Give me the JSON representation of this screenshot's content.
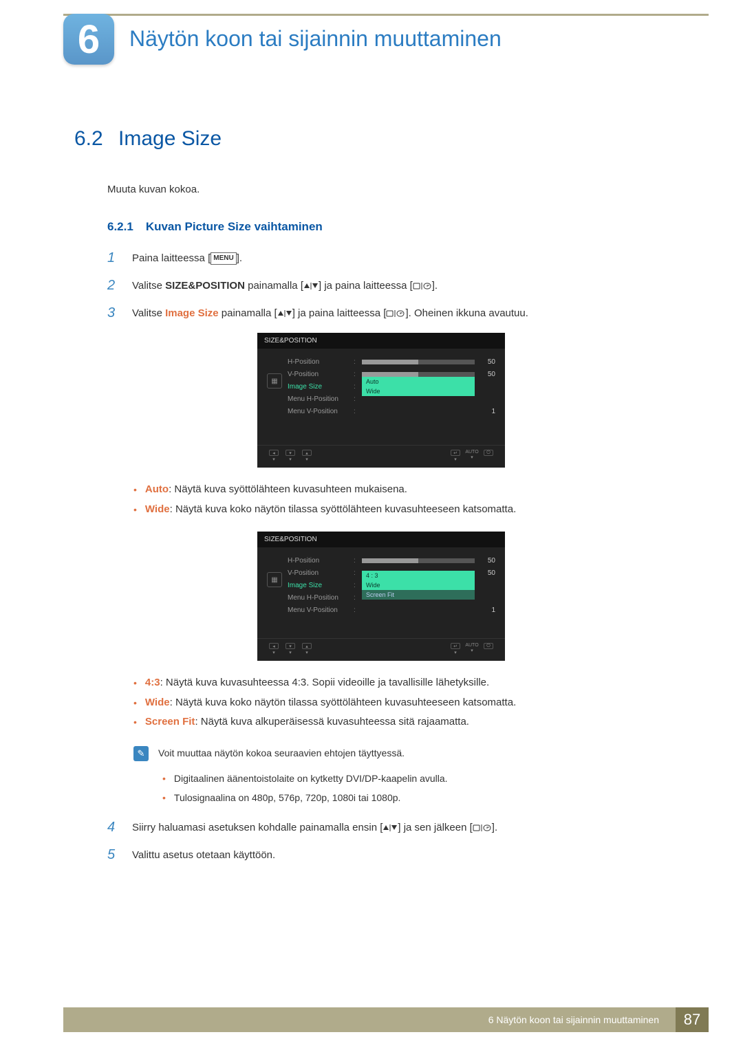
{
  "chapter": {
    "number": "6",
    "title": "Näytön koon tai sijainnin muuttaminen"
  },
  "section": {
    "number": "6.2",
    "title": "Image Size"
  },
  "intro": "Muuta kuvan kokoa.",
  "subsection": {
    "number": "6.2.1",
    "title": "Kuvan Picture Size vaihtaminen"
  },
  "steps": {
    "s1_num": "1",
    "s1_a": "Paina laitteessa [",
    "s1_menu": "MENU",
    "s1_b": "].",
    "s2_num": "2",
    "s2_a": "Valitse ",
    "s2_kw": "SIZE&POSITION",
    "s2_b": " painamalla [",
    "s2_c": "] ja paina laitteessa [",
    "s2_d": "].",
    "s3_num": "3",
    "s3_a": "Valitse ",
    "s3_kw": "Image Size",
    "s3_b": " painamalla [",
    "s3_c": "] ja paina laitteessa [",
    "s3_d": "]. Oheinen ikkuna avautuu.",
    "s4_num": "4",
    "s4_a": "Siirry haluamasi asetuksen kohdalle painamalla ensin [",
    "s4_b": "] ja sen jälkeen [",
    "s4_c": "].",
    "s5_num": "5",
    "s5_text": "Valittu asetus otetaan käyttöön."
  },
  "osd1": {
    "title": "SIZE&POSITION",
    "rows": {
      "hpos": "H-Position",
      "vpos": "V-Position",
      "imgsize": "Image Size",
      "mhpos": "Menu H-Position",
      "mvpos": "Menu V-Position"
    },
    "vals": {
      "hpos": "50",
      "vpos": "50",
      "mvpos": "1"
    },
    "options": {
      "o1": "Auto",
      "o2": "Wide"
    },
    "footer_auto": "AUTO"
  },
  "osd2": {
    "title": "SIZE&POSITION",
    "rows": {
      "hpos": "H-Position",
      "vpos": "V-Position",
      "imgsize": "Image Size",
      "mhpos": "Menu H-Position",
      "mvpos": "Menu V-Position"
    },
    "vals": {
      "hpos": "50",
      "vpos": "50",
      "mvpos": "1"
    },
    "options": {
      "o1": "4 : 3",
      "o2": "Wide",
      "o3": "Screen Fit"
    },
    "footer_auto": "AUTO"
  },
  "bullets1": {
    "b1_kw": "Auto",
    "b1_txt": ": Näytä kuva syöttölähteen kuvasuhteen mukaisena.",
    "b2_kw": "Wide",
    "b2_txt": ": Näytä kuva koko näytön tilassa syöttölähteen kuvasuhteeseen katsomatta."
  },
  "bullets2": {
    "b1_kw": "4:3",
    "b1_txt": ": Näytä kuva kuvasuhteessa 4:3. Sopii videoille ja tavallisille lähetyksille.",
    "b2_kw": "Wide",
    "b2_txt": ": Näytä kuva koko näytön tilassa syöttölähteen kuvasuhteeseen katsomatta.",
    "b3_kw": "Screen Fit",
    "b3_txt": ": Näytä kuva alkuperäisessä kuvasuhteessa sitä rajaamatta."
  },
  "note": {
    "intro": "Voit muuttaa näytön kokoa seuraavien ehtojen täyttyessä.",
    "n1": "Digitaalinen äänentoistolaite on kytketty DVI/DP-kaapelin avulla.",
    "n2": "Tulosignaalina on 480p, 576p, 720p, 1080i tai 1080p."
  },
  "footer": {
    "text": "6 Näytön koon tai sijainnin muuttaminen",
    "page": "87"
  }
}
